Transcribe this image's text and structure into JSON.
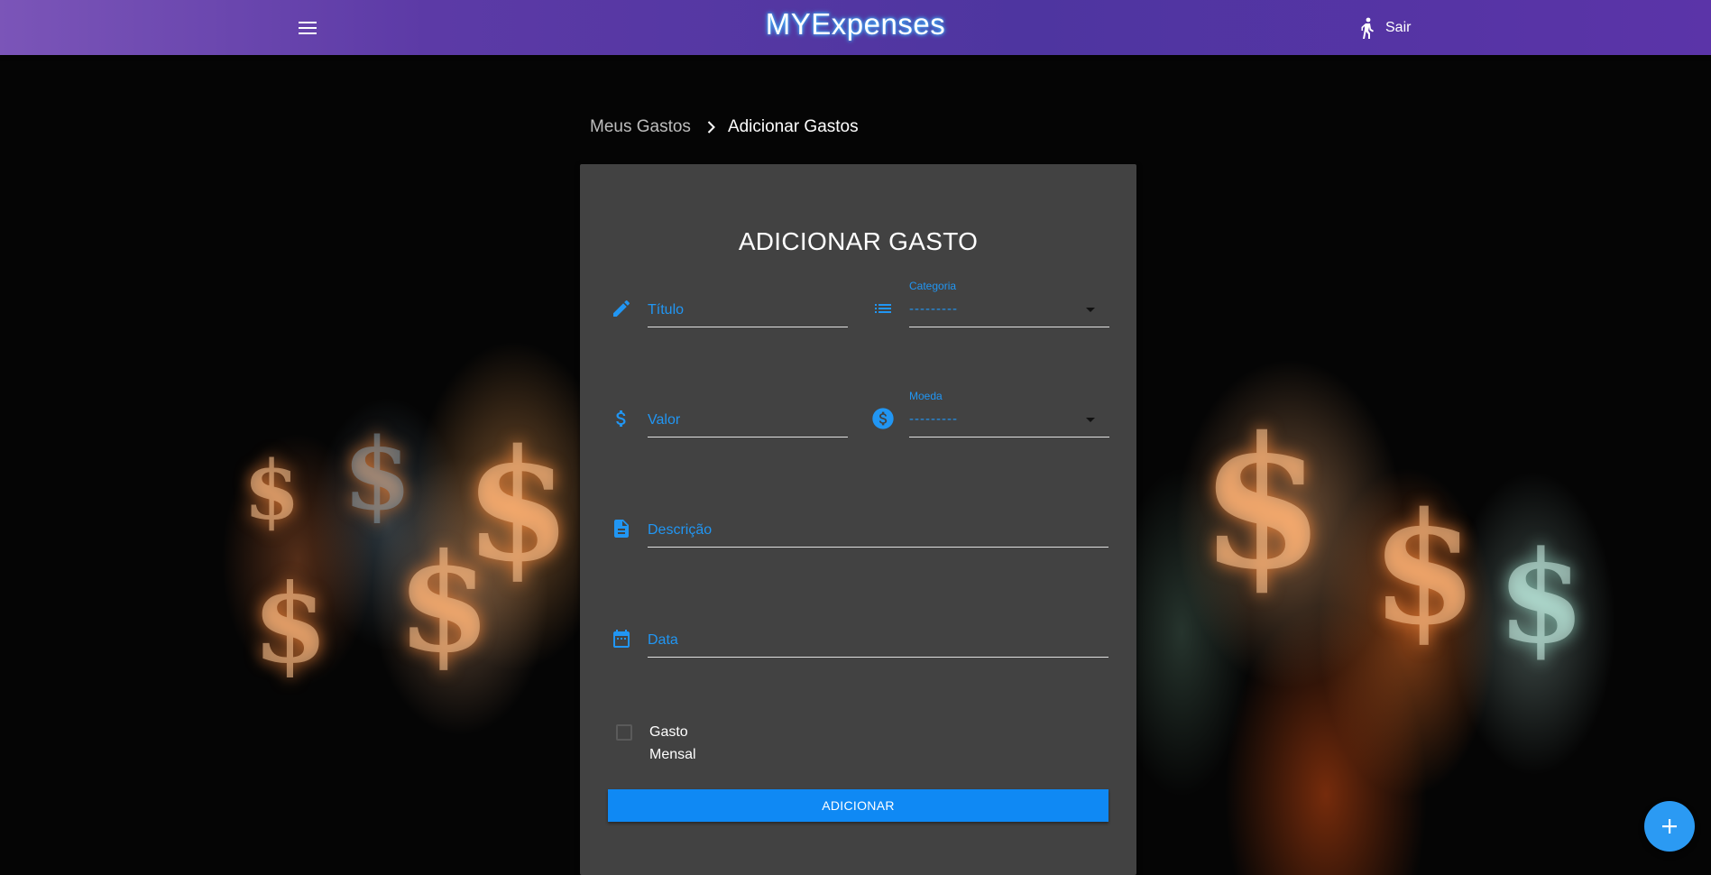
{
  "header": {
    "brand": "MYExpenses",
    "logout_label": "Sair",
    "menu_icon": "menu-icon",
    "logout_icon": "walking-person-icon",
    "background_gradient": [
      "#7b55b8",
      "#4e35a0"
    ]
  },
  "breadcrumb": {
    "parent": "Meus Gastos",
    "current": "Adicionar Gastos"
  },
  "form": {
    "title": "ADICIONAR GASTO",
    "titulo": {
      "label": "Título",
      "icon": "pencil-icon"
    },
    "categoria": {
      "label": "Categoria",
      "selected": "---------",
      "icon": "list-icon"
    },
    "valor": {
      "label": "Valor",
      "icon": "dollar-icon"
    },
    "moeda": {
      "label": "Moeda",
      "selected": "---------",
      "icon": "currency-circle-icon"
    },
    "descricao": {
      "label": "Descrição",
      "icon": "document-icon"
    },
    "data": {
      "label": "Data",
      "icon": "calendar-icon"
    },
    "monthly_checkbox": {
      "label": "Gasto Mensal",
      "checked": false
    },
    "submit_label": "ADICIONAR"
  },
  "fab": {
    "label": "+",
    "icon": "plus-icon"
  },
  "colors": {
    "accent": "#2196f3",
    "button": "#0f89f4",
    "card": "#424242"
  }
}
